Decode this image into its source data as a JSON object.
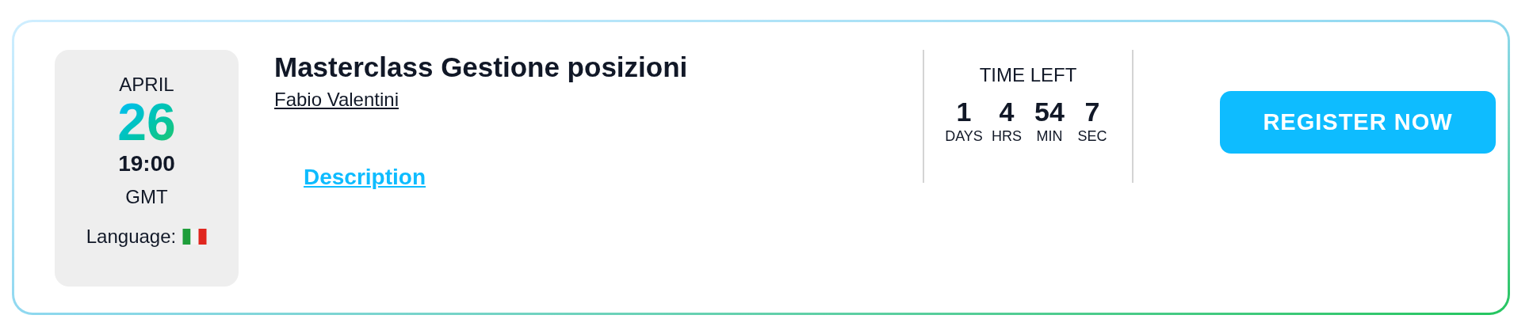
{
  "date": {
    "month": "APRIL",
    "day": "26",
    "time": "19:00",
    "timezone": "GMT",
    "language_label": "Language:"
  },
  "event": {
    "title": "Masterclass Gestione posizioni",
    "speaker": "Fabio Valentini",
    "description_link": "Description"
  },
  "countdown": {
    "heading": "TIME LEFT",
    "units": [
      {
        "value": "1",
        "unit": "DAYS"
      },
      {
        "value": "4",
        "unit": "HRS"
      },
      {
        "value": "54",
        "unit": "MIN"
      },
      {
        "value": "7",
        "unit": "SEC"
      }
    ]
  },
  "register_button": "REGISTER NOW"
}
